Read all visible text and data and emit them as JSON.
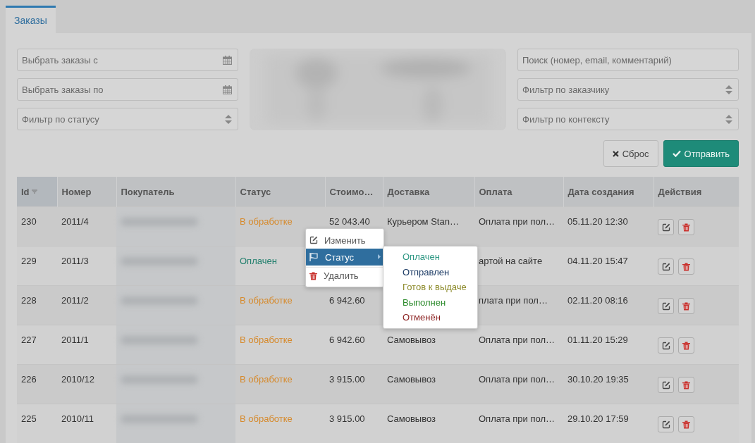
{
  "tabs": [
    {
      "label": "Заказы",
      "selected": true
    }
  ],
  "filters": {
    "left": [
      {
        "kind": "date",
        "placeholder": "Выбрать заказы с"
      },
      {
        "kind": "date",
        "placeholder": "Выбрать заказы по"
      },
      {
        "kind": "select",
        "placeholder": "Фильтр по статусу"
      }
    ],
    "right": [
      {
        "kind": "text",
        "placeholder": "Поиск (номер, email, комментарий)"
      },
      {
        "kind": "select",
        "placeholder": "Фильтр по заказчику"
      },
      {
        "kind": "select",
        "placeholder": "Фильтр по контексту"
      }
    ]
  },
  "buttons": [
    {
      "kind": "reset",
      "label": "Сброс"
    },
    {
      "kind": "submit",
      "label": "Отправить"
    }
  ],
  "table": {
    "columns": [
      {
        "label": "Id",
        "sortable": true
      },
      {
        "label": "Номер",
        "sortable": false
      },
      {
        "label": "Покупатель",
        "sortable": false
      },
      {
        "label": "Статус",
        "sortable": false
      },
      {
        "label": "Стоимо…",
        "sortable": false
      },
      {
        "label": "Доставка",
        "sortable": false
      },
      {
        "label": "Оплата",
        "sortable": false
      },
      {
        "label": "Дата создания",
        "sortable": false
      },
      {
        "label": "Действия",
        "sortable": false
      }
    ],
    "rows": [
      {
        "id": "230",
        "number": "2011/4",
        "status": {
          "label": "В обработке",
          "color": "#d68a2c"
        },
        "cost": "52 043.40",
        "delivery": "Курьером Stan…",
        "payment": "Оплата при пол…",
        "date": "05.11.20 12:30"
      },
      {
        "id": "229",
        "number": "2011/3",
        "status": {
          "label": "Оплачен",
          "color": "#23806e"
        },
        "payment": "артой на сайте",
        "date": "04.11.20 15:47"
      },
      {
        "id": "228",
        "number": "2011/2",
        "status": {
          "label": "В обработке",
          "color": "#d68a2c"
        },
        "cost": "6 942.60",
        "payment": "плата при пол…",
        "date": "02.11.20 08:16"
      },
      {
        "id": "227",
        "number": "2011/1",
        "status": {
          "label": "В обработке",
          "color": "#d68a2c"
        },
        "cost": "6 942.60",
        "delivery": "Самовывоз",
        "payment": "Оплата при пол…",
        "date": "01.11.20 15:29"
      },
      {
        "id": "226",
        "number": "2010/12",
        "status": {
          "label": "В обработке",
          "color": "#d68a2c"
        },
        "cost": "3 915.00",
        "delivery": "Самовывоз",
        "payment": "Оплата при пол…",
        "date": "30.10.20 19:35"
      },
      {
        "id": "225",
        "number": "2010/11",
        "status": {
          "label": "В обработке",
          "color": "#d68a2c"
        },
        "cost": "3 915.00",
        "delivery": "Самовывоз",
        "payment": "Оплата при пол…",
        "date": "29.10.20 17:59"
      }
    ]
  },
  "context_menu": {
    "items": [
      {
        "kind": "edit",
        "label": "Изменить",
        "selected": false,
        "submenu": false
      },
      {
        "kind": "flag",
        "label": "Статус",
        "selected": true,
        "submenu": true
      },
      {
        "kind": "trash",
        "label": "Удалить",
        "selected": false,
        "submenu": false
      }
    ],
    "submenu": [
      {
        "label": "Оплачен",
        "color": "#2f9884"
      },
      {
        "label": "Отправлен",
        "color": "#1b3a64"
      },
      {
        "label": "Готов к выдаче",
        "color": "#8c8a2a"
      },
      {
        "label": "Выполнен",
        "color": "#2b8a2b"
      },
      {
        "label": "Отменён",
        "color": "#8a1f1f"
      }
    ]
  }
}
